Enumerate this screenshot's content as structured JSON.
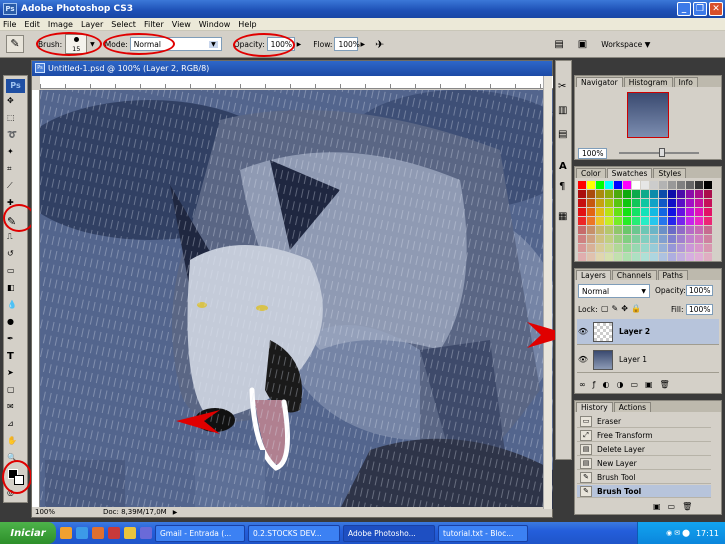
{
  "app": {
    "title": "Adobe Photoshop CS3"
  },
  "menu": [
    "File",
    "Edit",
    "Image",
    "Layer",
    "Select",
    "Filter",
    "View",
    "Window",
    "Help"
  ],
  "options": {
    "brush_label": "Brush:",
    "brush_size": "15",
    "mode_label": "Mode:",
    "mode_value": "Normal",
    "opacity_label": "Opacity:",
    "opacity_value": "100%",
    "flow_label": "Flow:",
    "flow_value": "100%",
    "workspace_label": "Workspace ▼"
  },
  "document": {
    "title": "Untitled-1.psd @ 100% (Layer 2, RGB/8)",
    "zoom": "100%",
    "doc_info": "Doc: 8,39M/17,0M"
  },
  "navigator": {
    "tabs": [
      "Navigator",
      "Histogram",
      "Info"
    ],
    "zoom": "100%"
  },
  "color_panel": {
    "tabs": [
      "Color",
      "Swatches",
      "Styles"
    ]
  },
  "layers": {
    "tabs": [
      "Layers",
      "Channels",
      "Paths"
    ],
    "blend_mode": "Normal",
    "opacity_label": "Opacity:",
    "opacity_value": "100%",
    "lock_label": "Lock:",
    "fill_label": "Fill:",
    "fill_value": "100%",
    "items": [
      {
        "name": "Layer 2",
        "selected": true
      },
      {
        "name": "Layer 1",
        "selected": false
      }
    ]
  },
  "history": {
    "tabs": [
      "History",
      "Actions"
    ],
    "items": [
      "Eraser",
      "Free Transform",
      "Delete Layer",
      "New Layer",
      "Brush Tool",
      "Brush Tool"
    ]
  },
  "taskbar": {
    "start_label": "Iniciar",
    "tasks": [
      "Gmail - Entrada (...",
      "0.2.STOCKS DEV...",
      "Adobe Photosho...",
      "tutorial.txt - Bloc..."
    ],
    "active_task": 2,
    "clock": "17:11"
  },
  "colors": {
    "highlight_red": "#e00000",
    "xp_blue": "#245edb",
    "panel_gray": "#d4d0c8"
  }
}
